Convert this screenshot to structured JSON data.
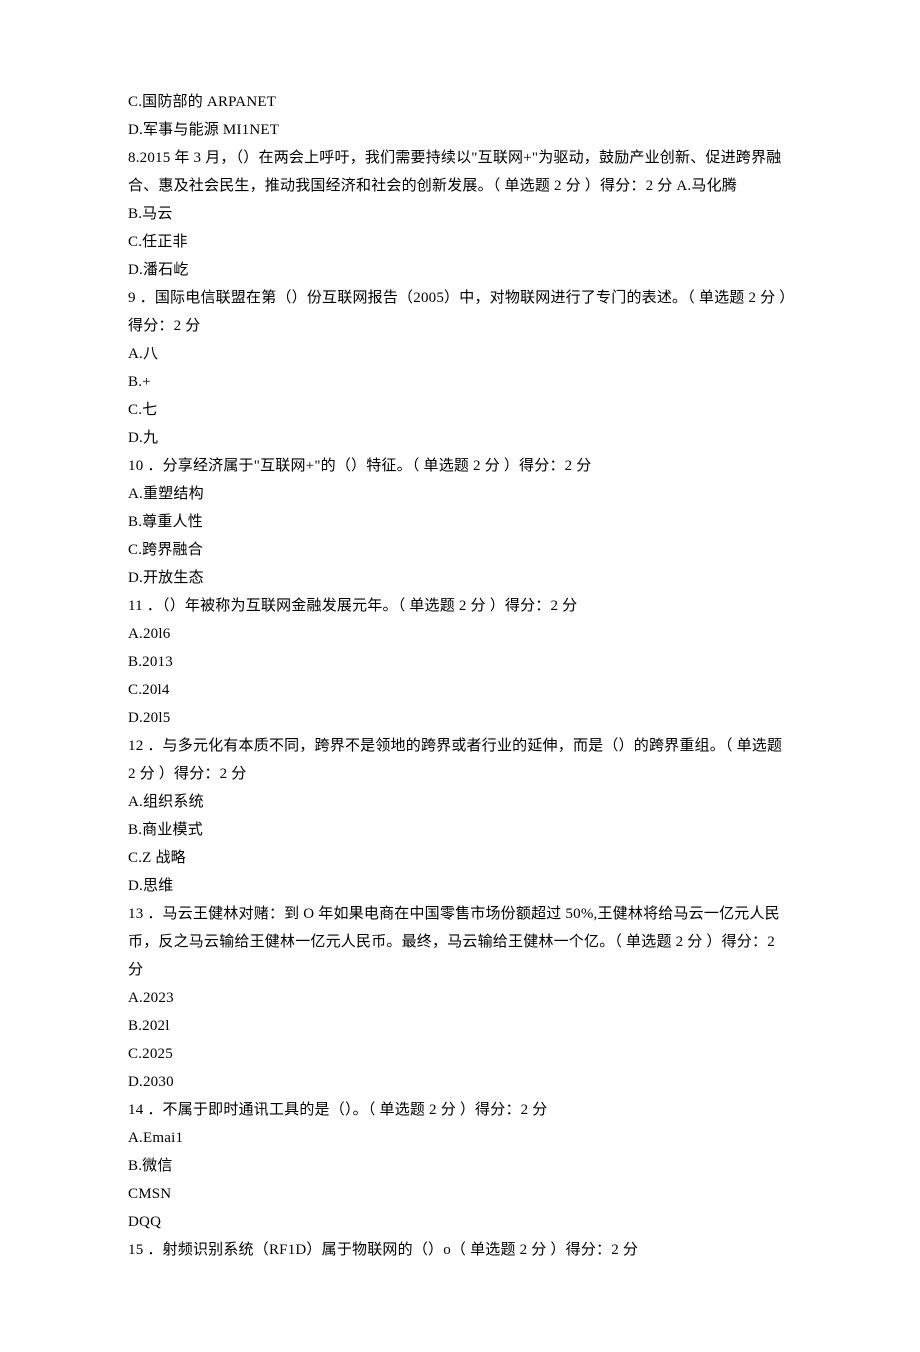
{
  "lines": [
    "C.国防部的 ARPANET",
    "D.军事与能源 MI1NET",
    "8.2015 年 3 月，（）在两会上呼吁，我们需要持续以\"互联网+\"为驱动，鼓励产业创新、促进跨界融合、惠及社会民生，推动我国经济和社会的创新发展。（ 单选题 2 分 ）得分：2 分 A.马化腾",
    "B.马云",
    "C.任正非",
    "D.潘石屹",
    "9 ．国际电信联盟在第（）份互联网报告（2005）中，对物联网进行了专门的表述。（ 单选题 2 分 ）得分：2 分",
    "A.八",
    "B.+",
    "C.七",
    "D.九",
    "10 ．分享经济属于\"互联网+\"的（）特征。（ 单选题 2 分 ）得分：2 分",
    "A.重塑结构",
    "B.尊重人性",
    "C.跨界融合",
    "D.开放生态",
    "11 ．（）年被称为互联网金融发展元年。（ 单选题 2 分 ）得分：2 分",
    "A.20l6",
    "B.2013",
    "C.20l4",
    "D.20l5",
    "12 ．与多元化有本质不同，跨界不是领地的跨界或者行业的延伸，而是（）的跨界重组。（ 单选题 2 分 ）得分：2 分",
    "A.组织系统",
    "B.商业模式",
    "C.Z 战略",
    "D.思维",
    "13 ．马云王健林对赌：到 O 年如果电商在中国零售市场份额超过 50%,王健林将给马云一亿元人民币，反之马云输给王健林一亿元人民币。最终，马云输给王健林一个亿。（ 单选题 2 分 ）得分：2 分",
    "A.2023",
    "B.202l",
    "C.2025",
    "D.2030",
    "14 ．不属于即时通讯工具的是（）。（ 单选题 2 分 ）得分：2 分",
    "A.Emai1",
    "B.微信",
    "CMSN",
    "DQQ",
    "15 ．射频识别系统（RF1D）属于物联网的（）o（ 单选题 2 分 ）得分：2 分"
  ]
}
